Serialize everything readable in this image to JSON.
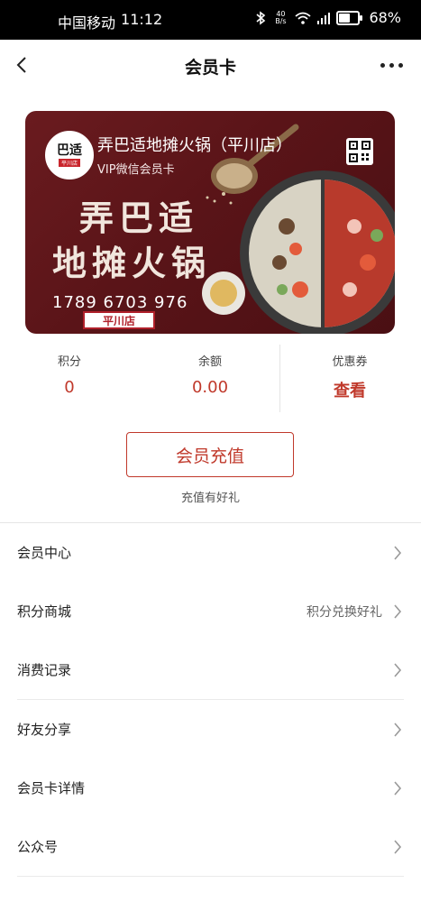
{
  "status_bar": {
    "carrier": "中国移动",
    "time": "11:12",
    "net_speed_top": "40",
    "net_speed_bottom": "B/s",
    "battery": "68%"
  },
  "nav": {
    "title": "会员卡"
  },
  "card": {
    "logo_text": "巴适",
    "logo_sub": "平川店",
    "store_name": "弄巴适地摊火锅（平川店）",
    "card_type": "VIP微信会员卡",
    "brand_line1": "弄巴适",
    "brand_line2": "地摊火锅",
    "card_number": "1789 6703 976",
    "stamp": "平川店",
    "colors": {
      "background": "#5a1418",
      "accent": "#c9252c"
    }
  },
  "stats": {
    "points": {
      "label": "积分",
      "value": "0"
    },
    "balance": {
      "label": "余额",
      "value": "0.00"
    },
    "coupons": {
      "label": "优惠券",
      "value": "查看"
    }
  },
  "recharge": {
    "button_label": "会员充值",
    "note": "充值有好礼"
  },
  "menu": [
    {
      "label": "会员中心",
      "extra": ""
    },
    {
      "label": "积分商城",
      "extra": "积分兑换好礼"
    },
    {
      "label": "消费记录",
      "extra": ""
    },
    {
      "label": "好友分享",
      "extra": ""
    },
    {
      "label": "会员卡详情",
      "extra": ""
    },
    {
      "label": "公众号",
      "extra": ""
    }
  ],
  "colors": {
    "accent_red": "#c0392b",
    "status_bar": "#000000"
  }
}
